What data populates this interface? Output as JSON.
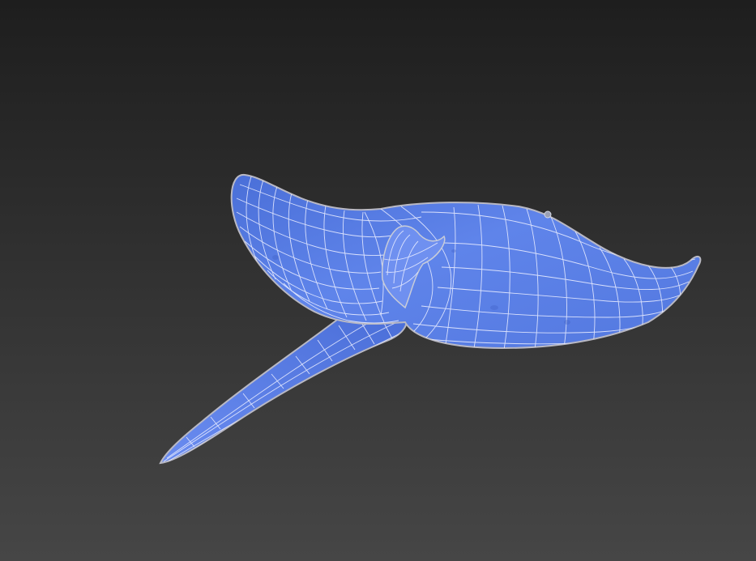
{
  "viewport": {
    "shading_mode": "wireframe-on-shaded",
    "background": {
      "top_color": "#1e1e1e",
      "bottom_color": "#464646"
    }
  },
  "model": {
    "subject": "stingray",
    "surface_color": "#5b7fe6",
    "surface_shadow_color": "#3f5fc4",
    "wire_color": "#e8ecff",
    "edge_color": "#b9b9c4"
  }
}
